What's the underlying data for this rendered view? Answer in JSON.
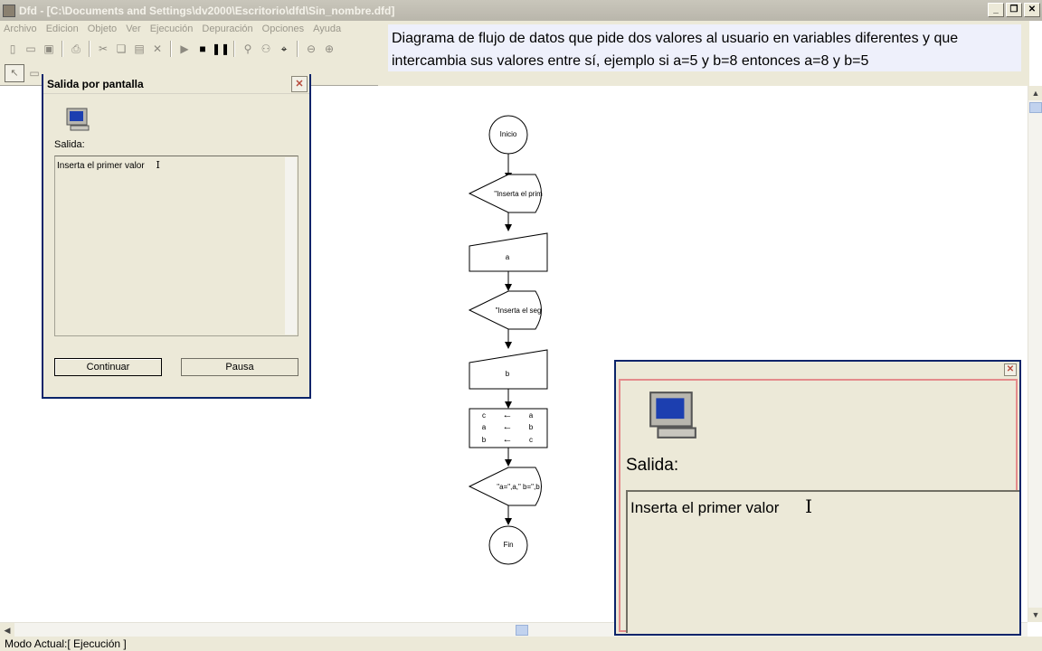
{
  "window": {
    "title": "Dfd - [C:\\Documents and Settings\\dv2000\\Escritorio\\dfd\\Sin_nombre.dfd]",
    "controls": [
      "minimize-icon",
      "restore-icon",
      "close-icon"
    ]
  },
  "menu": [
    "Archivo",
    "Edicion",
    "Objeto",
    "Ver",
    "Ejecución",
    "Depuración",
    "Opciones",
    "Ayuda"
  ],
  "description": "Diagrama de flujo de datos que pide dos valores al usuario en variables diferentes y que intercambia sus valores entre sí, ejemplo si a=5 y b=8 entonces a=8 y b=5",
  "flowchart": {
    "start": "Inicio",
    "out1": "\"Inserta el prim",
    "in1": "a",
    "out2": "\"Inserta el seg",
    "in2": "b",
    "assign": [
      {
        "left": "c",
        "right": "a"
      },
      {
        "left": "a",
        "right": "b"
      },
      {
        "left": "b",
        "right": "c"
      }
    ],
    "assign_arrow": "←",
    "out3": "\"a=\",a,\" b=\",b",
    "end": "Fin"
  },
  "dialog": {
    "title": "Salida por pantalla",
    "label": "Salida:",
    "output": "Inserta el primer valor",
    "continue_label": "Continuar",
    "pause_label": "Pausa"
  },
  "zoom": {
    "label": "Salida:",
    "output": "Inserta el primer valor"
  },
  "status": "Modo Actual:[ Ejecución ]"
}
